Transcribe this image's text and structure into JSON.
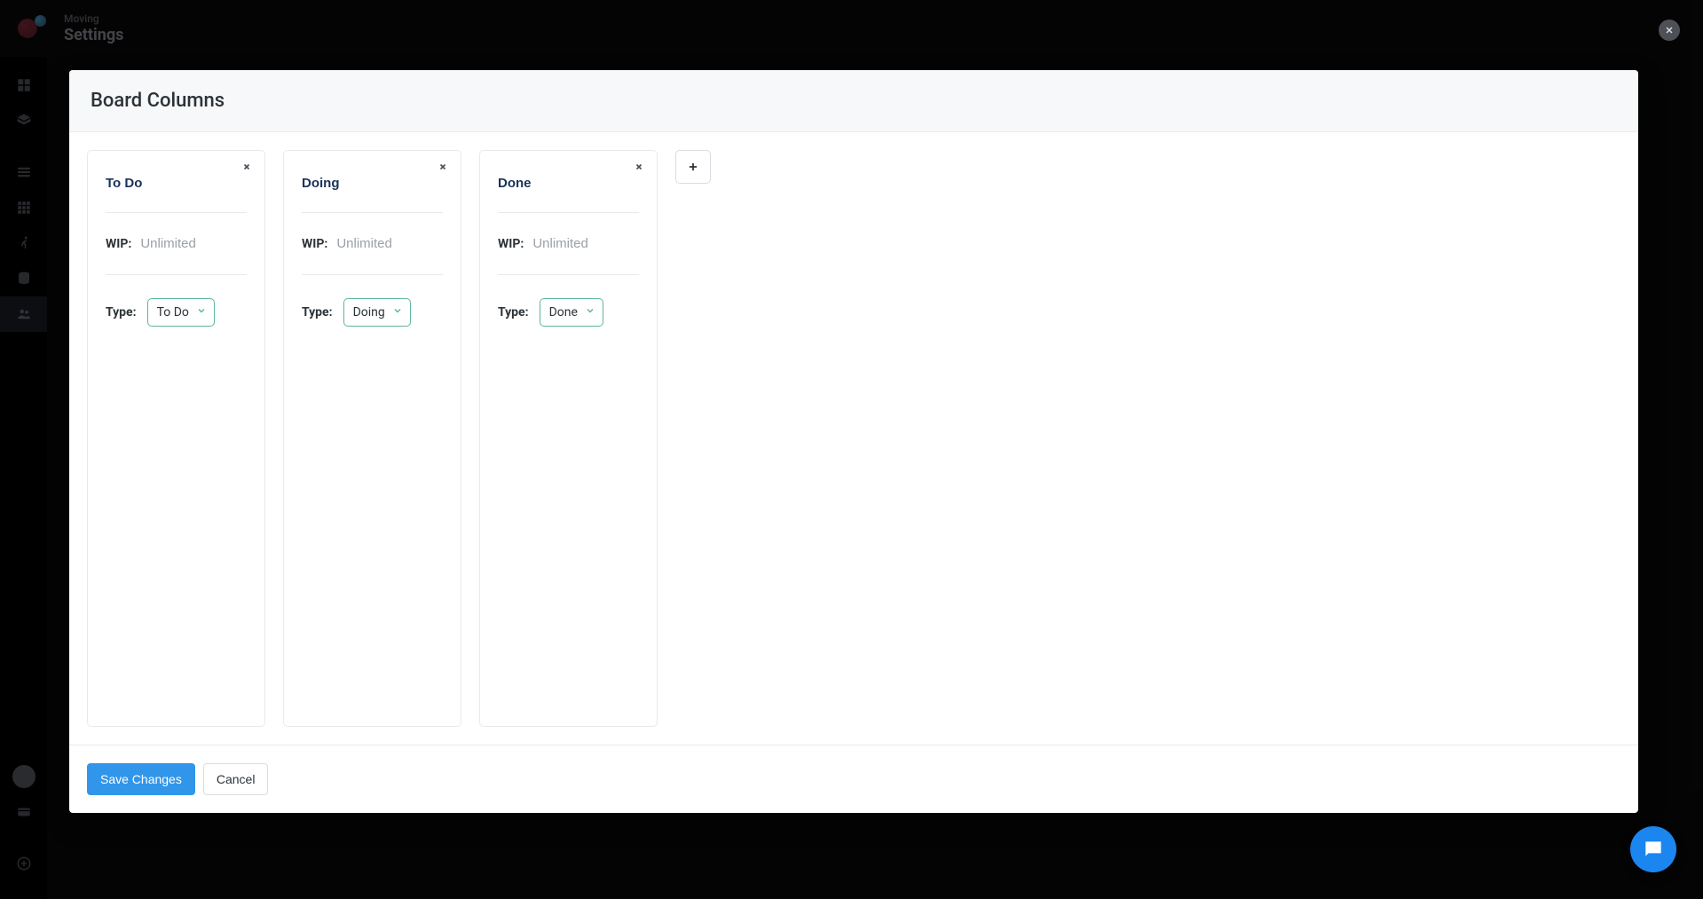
{
  "header": {
    "breadcrumb": "Moving",
    "page_title": "Settings"
  },
  "sidebar": {
    "icons": [
      "dashboard-icon",
      "stack-icon",
      "list-icon",
      "grid-icon",
      "runner-icon",
      "database-icon",
      "users-icon"
    ],
    "bottom_icons": [
      "avatar-icon",
      "card-icon",
      "add-circle-icon"
    ]
  },
  "modal": {
    "title": "Board Columns",
    "wip_label": "WIP:",
    "wip_placeholder": "Unlimited",
    "type_label": "Type:",
    "columns": [
      {
        "name": "To Do",
        "wip": "",
        "type": "To Do"
      },
      {
        "name": "Doing",
        "wip": "",
        "type": "Doing"
      },
      {
        "name": "Done",
        "wip": "",
        "type": "Done"
      }
    ],
    "save_label": "Save Changes",
    "cancel_label": "Cancel"
  }
}
